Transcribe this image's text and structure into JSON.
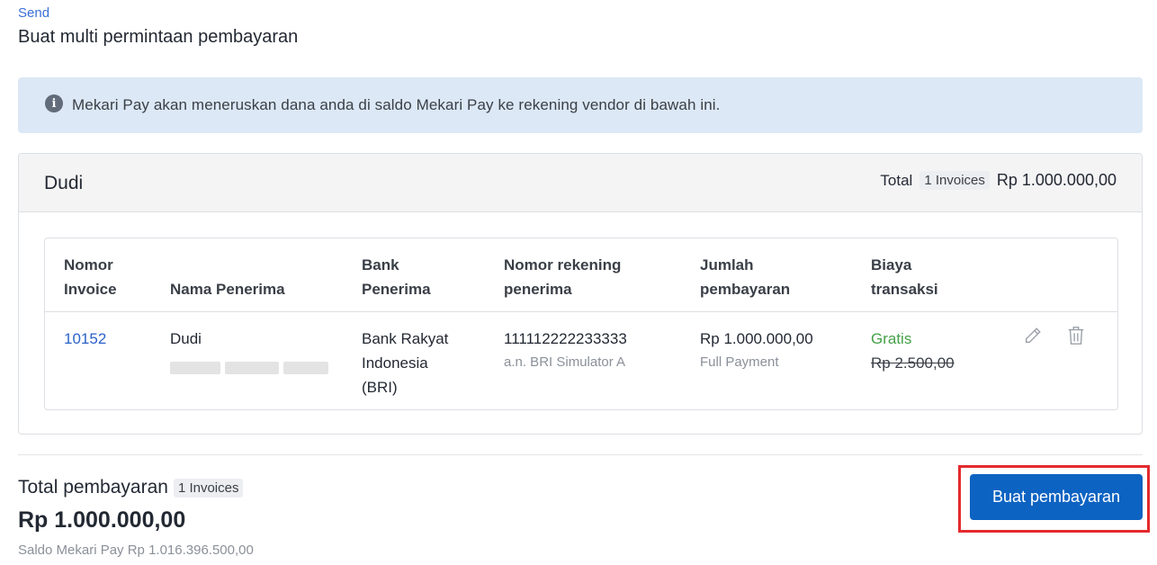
{
  "breadcrumb": "Send",
  "page_title": "Buat multi permintaan pembayaran",
  "info_banner": {
    "icon": "info-icon",
    "text": "Mekari Pay akan meneruskan dana anda di saldo Mekari Pay ke rekening vendor di bawah ini."
  },
  "vendor": {
    "name": "Dudi",
    "total_label": "Total",
    "invoice_count": "1 Invoices",
    "total_amount": "Rp 1.000.000,00"
  },
  "table": {
    "headers": {
      "invoice": [
        "Nomor",
        "Invoice"
      ],
      "recipient": "Nama Penerima",
      "bank": [
        "Bank",
        "Penerima"
      ],
      "account": [
        "Nomor rekening",
        "penerima"
      ],
      "amount": [
        "Jumlah",
        "pembayaran"
      ],
      "fee": [
        "Biaya",
        "transaksi"
      ]
    },
    "rows": [
      {
        "invoice": "10152",
        "recipient": "Dudi",
        "bank": [
          "Bank Rakyat",
          "Indonesia",
          "(BRI)"
        ],
        "account_number": "111112222233333",
        "account_holder": "a.n. BRI Simulator A",
        "amount": "Rp 1.000.000,00",
        "payment_type": "Full Payment",
        "fee": "Gratis",
        "fee_original": "Rp 2.500,00",
        "actions": [
          "pencil-icon",
          "trash-icon"
        ]
      }
    ]
  },
  "summary": {
    "label": "Total pembayaran",
    "invoice_count": "1 Invoices",
    "amount": "Rp 1.000.000,00",
    "saldo": "Saldo Mekari Pay Rp 1.016.396.500,00"
  },
  "submit_label": "Buat pembayaran",
  "colors": {
    "primary": "#0d63c2",
    "link": "#2b62c9",
    "success": "#43a047",
    "banner_bg": "#dce8f5",
    "highlight": "#e32a2e"
  }
}
